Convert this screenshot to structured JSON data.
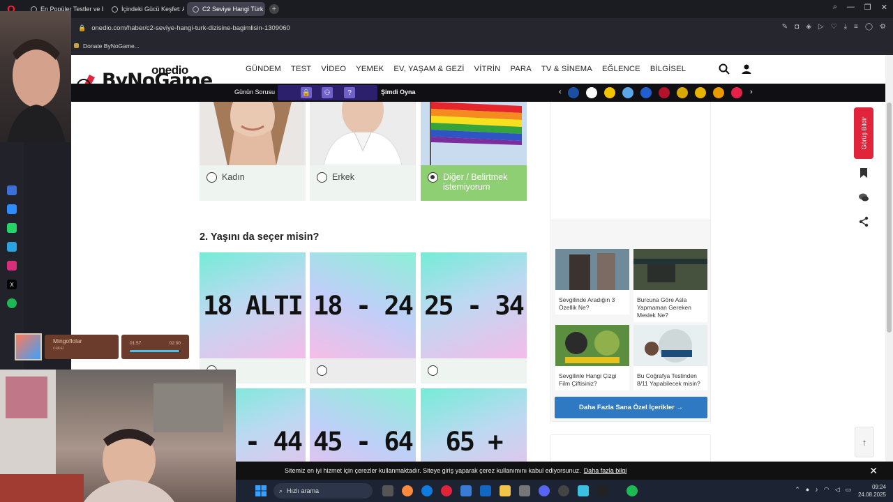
{
  "browser": {
    "tabs": [
      {
        "label": "En Popüler Testler ve Eğle",
        "active": false
      },
      {
        "label": "İçindeki Gücü Keşfet: Askı",
        "active": false
      },
      {
        "label": "C2 Seviye Hangi Türk Dizi",
        "active": true
      }
    ],
    "url": "onedio.com/haber/c2-seviye-hangi-turk-dizisine-bagimlisin-1309060",
    "bookmark": "Donate ByNoGame..."
  },
  "header": {
    "logo_onedio": "onedio",
    "logo_overlay": "ByNoGame",
    "nav": [
      "GÜNDEM",
      "TEST",
      "VİDEO",
      "YEMEK",
      "EV, YAŞAM & GEZİ",
      "VİTRİN",
      "PARA",
      "TV & SİNEMA",
      "EĞLENCE",
      "BİLGİSEL"
    ]
  },
  "topbar": {
    "game_label": "Günün Sorusu",
    "game_question_mark": "?",
    "play_label": "Şimdi Oyna"
  },
  "q1": {
    "options": [
      {
        "label": "Kadın",
        "selected": false
      },
      {
        "label": "Erkek",
        "selected": false
      },
      {
        "label": "Diğer / Belirtmek istemiyorum",
        "selected": true
      }
    ]
  },
  "q2": {
    "title": "2. Yaşını da seçer misin?",
    "options": [
      "18 ALTI",
      "18 - 24",
      "25 - 34",
      "- 44",
      "45 - 64",
      "65 +"
    ]
  },
  "sidebar": {
    "recs": [
      {
        "title": "Sevgilinde Aradığın 3 Özellik Ne?"
      },
      {
        "title": "Burcuna Göre Asla Yapmaman Gereken Meslek Ne?"
      },
      {
        "title": "Sevgilinle Hangi Çizgi Film Çiftisiniz?"
      },
      {
        "title": "Bu Coğrafya Testinden 8/11 Yapabilecek misin?"
      }
    ],
    "more_button": "Daha Fazla Sana Özel İçerikler →",
    "opinion_button": "Görüş Bildir"
  },
  "cookie": {
    "text": "Sitemiz en iyi hizmet için çerezler kullanmaktadır. Siteye giriş yaparak çerez kullanımını kabul ediyorsunuz.",
    "link": "Daha fazla bilgi"
  },
  "taskbar": {
    "search_placeholder": "Hızlı arama",
    "time": "09:24",
    "date": "24.08.2025"
  },
  "music": {
    "title": "Mingoflolar",
    "artist": "cakal",
    "elapsed": "01:57",
    "total": "02:00",
    "progress_percent": 97
  },
  "colors": {
    "selected_green": "#8fcf74",
    "accent_red": "#e0243a",
    "button_blue": "#2f79c2"
  }
}
